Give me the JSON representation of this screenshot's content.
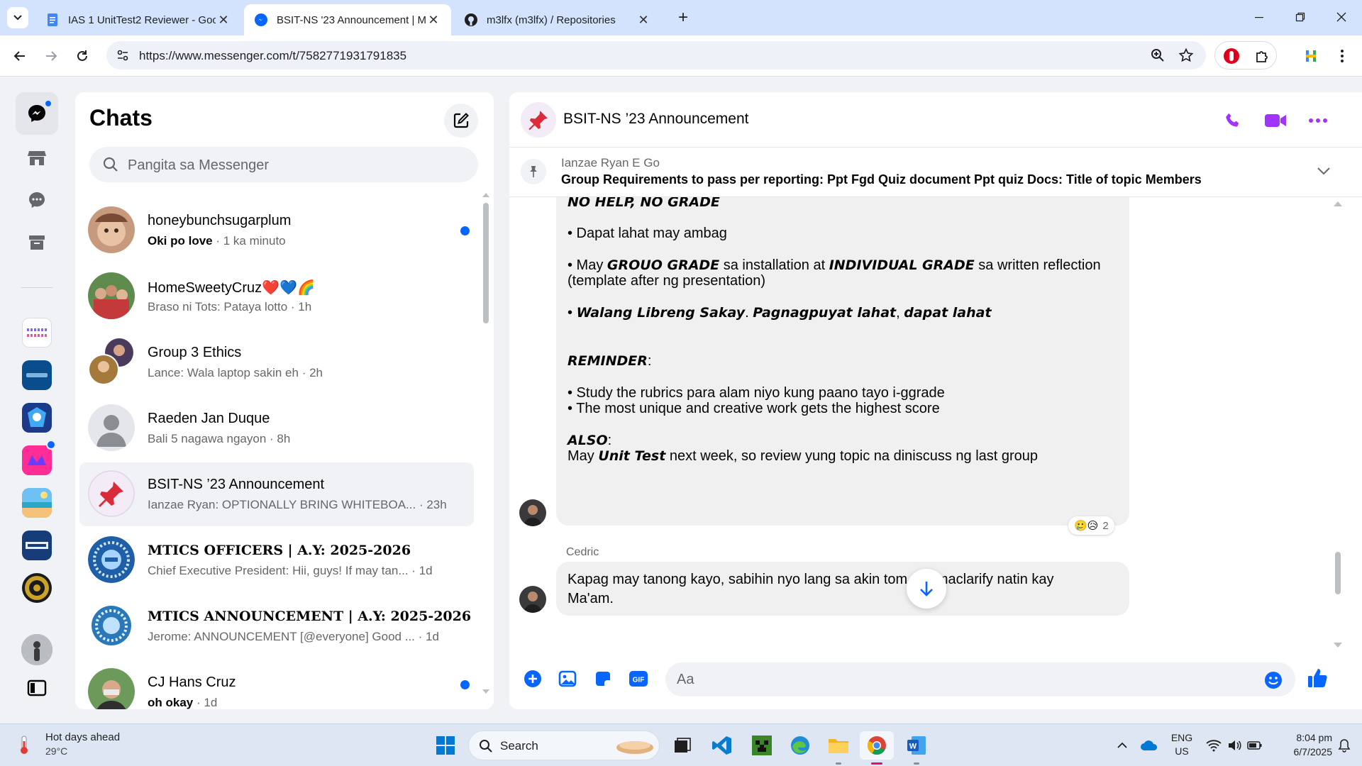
{
  "browser": {
    "tabs": [
      {
        "title": "IAS 1 UnitTest2 Reviewer - Goo",
        "icon": "google-docs-icon"
      },
      {
        "title": "BSIT-NS '23 Announcement | M",
        "icon": "messenger-icon"
      },
      {
        "title": "m3lfx (m3lfx) / Repositories",
        "icon": "github-icon"
      }
    ],
    "url": "https://www.messenger.com/t/7582771931791835"
  },
  "chats_panel": {
    "title": "Chats",
    "search_placeholder": "Pangita sa Messenger",
    "conversations": [
      {
        "name": "honeybunchsugarplum",
        "preview": "Oki po love",
        "time": "· 1 ka minuto",
        "unread": true
      },
      {
        "name": "HomeSweetyCruz❤️💙🌈",
        "preview": "Braso ni Tots: Pataya lotto",
        "time": "· 1h",
        "unread": false
      },
      {
        "name": "Group 3 Ethics",
        "preview": "Lance: Wala laptop sakin eh",
        "time": "· 2h",
        "unread": false
      },
      {
        "name": "Raeden Jan Duque",
        "preview": "Bali 5 nagawa ngayon",
        "time": "· 8h",
        "unread": false
      },
      {
        "name": "BSIT-NS ’23 Announcement",
        "preview": "Ianzae Ryan: OPTIONALLY BRING WHITEBOA...",
        "time": "· 23h",
        "unread": false
      },
      {
        "name": "MTICS OFFICERS | A.Y: 2025-2026",
        "preview": "Chief Executive President: Hii, guys! If may tan...",
        "time": "· 1d",
        "unread": false
      },
      {
        "name": "MTICS ANNOUNCEMENT | A.Y: 2025-2026",
        "preview": "Jerome: ANNOUNCEMENT [@everyone] Good ...",
        "time": "· 1d",
        "unread": false
      },
      {
        "name": "CJ Hans Cruz",
        "preview": "oh okay",
        "time": "· 1d",
        "unread": true
      }
    ]
  },
  "conversation": {
    "title": "BSIT-NS ’23 Announcement",
    "pinned": {
      "author": "Ianzae Ryan E Go",
      "text": "Group Requirements to pass per reporting: Ppt Fgd Quiz document Ppt quiz Docs: Title of topic Members"
    },
    "message1": {
      "line_no_help": "NO HELP, NO GRADE",
      "line_ambag": "• Dapat lahat may ambag",
      "grade_prefix": "• May ",
      "grade_b1": "GROUO GRADE",
      "grade_mid": " sa installation at ",
      "grade_b2": "INDIVIDUAL GRADE",
      "grade_suffix": " sa written reflection",
      "grade_line2": "(template after ng presentation)",
      "walang_b1": "Walang Libreng Sakay",
      "walang_b2": "Pagnagpuyat lahat",
      "walang_b3": "dapat lahat",
      "reminder_label": "REMINDER",
      "reminder_line1": "• Study the rubrics para alam niyo kung paano tayo i-ggrade",
      "reminder_line2": "• The most unique and creative work gets the highest score",
      "also_label": "ALSO",
      "also_prefix": "May ",
      "also_bold": "Unit Test",
      "also_suffix": " next week, so review yung topic na diniscuss ng last group",
      "reactions": "🥲😥",
      "reaction_count": "2"
    },
    "message2": {
      "sender": "Cedric",
      "line1": "Kapag may tanong kayo, sabihin nyo lang sa akin tom",
      "line1b": "a maclarify natin kay",
      "line2": "Ma'am."
    },
    "composer_placeholder": "Aa"
  },
  "taskbar": {
    "weather_title": "Hot days ahead",
    "weather_temp": "29°C",
    "search_label": "Search",
    "lang": "ENG",
    "region": "US",
    "time": "8:04 pm",
    "date": "6/7/2025"
  },
  "colors": {
    "accent": "#a033ff",
    "messenger_blue": "#0866ff",
    "chrome_tab_bar": "#d3e3fd"
  }
}
